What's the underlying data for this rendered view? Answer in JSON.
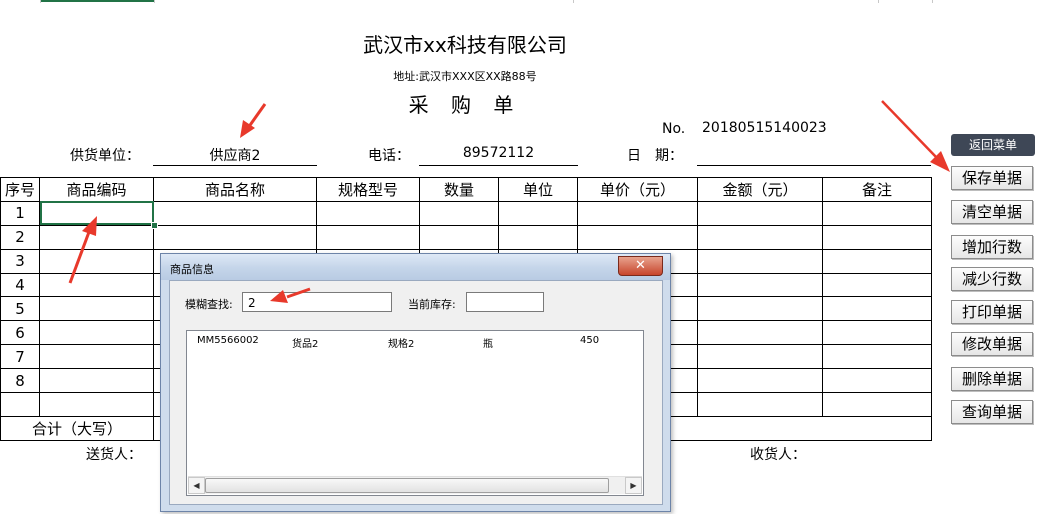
{
  "sheet": {
    "company_name": "武汉市xx科技有限公司",
    "address": "地址:武汉市XXX区XX路88号",
    "doc_title": "采 购 单",
    "no_label": "No.",
    "no_value": "20180515140023",
    "supplier_label": "供货单位：",
    "supplier_value": "供应商2",
    "phone_label": "电话：",
    "phone_value": "89572112",
    "date_label": "日　期：",
    "date_value": "",
    "columns": [
      "序号",
      "商品编码",
      "商品名称",
      "规格型号",
      "数量",
      "单位",
      "单价（元）",
      "金额（元）",
      "备注"
    ],
    "row_numbers": [
      "1",
      "2",
      "3",
      "4",
      "5",
      "6",
      "7",
      "8",
      ""
    ],
    "total_label": "合计（大写）",
    "deliverer_label": "送货人：",
    "receiver_label": "收货人："
  },
  "buttons": {
    "back_menu": "返回菜单",
    "save": "保存单据",
    "clear": "清空单据",
    "add_rows": "增加行数",
    "remove_rows": "减少行数",
    "print": "打印单据",
    "modify": "修改单据",
    "delete": "删除单据",
    "query": "查询单据"
  },
  "dialog": {
    "title": "商品信息",
    "close_glyph": "✕",
    "search_label": "模糊查找:",
    "search_value": "2",
    "stock_label": "当前库存:",
    "stock_value": "",
    "results": [
      {
        "code": "MM5566002",
        "name": "货品2",
        "spec": "规格2",
        "unit": "瓶",
        "qty": "450"
      }
    ],
    "scroll_left": "◀",
    "scroll_right": "▶"
  },
  "colors": {
    "arrow": "#e8392b",
    "selection": "#217346",
    "back_button": "#3e4756"
  }
}
